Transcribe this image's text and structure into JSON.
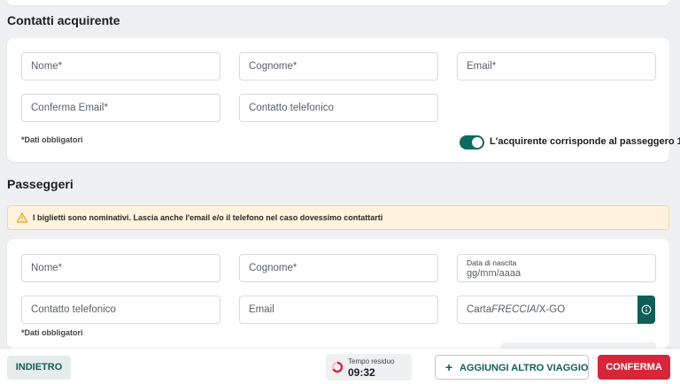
{
  "buyer": {
    "title": "Contatti acquirente",
    "nome_placeholder": "Nome*",
    "cognome_placeholder": "Cognome*",
    "email_placeholder": "Email*",
    "confirm_email_placeholder": "Conferma Email*",
    "phone_placeholder": "Contatto telefonico",
    "required_note": "*Dati obbligatori",
    "toggle_on": true,
    "toggle_label": "L'acquirente corrisponde al passeggero 1"
  },
  "passengers": {
    "title": "Passeggeri",
    "alert_text": "I biglietti sono nominativi. Lascia anche l'email e/o il telefono nel caso dovessimo contattarti",
    "nome_placeholder": "Nome*",
    "cognome_placeholder": "Cognome*",
    "birth_label": "Data di nascita",
    "birth_placeholder": "gg/mm/aaaa",
    "phone_placeholder": "Contatto telefonico",
    "email_placeholder": "Email",
    "card_prefix": "Carta",
    "card_brand": "FRECCIA",
    "card_suffix": "/X-GO",
    "required_note": "*Dati obbligatori"
  },
  "footer": {
    "back_label": "INDIETRO",
    "timer_label": "Tempo residuo",
    "timer_value": "09:32",
    "add_trip_label": "AGGIUNGI ALTRO VIAGGIO",
    "confirm_label": "CONFERMA"
  },
  "colors": {
    "accent": "#0e5f56",
    "confirm": "#d9253a",
    "warning_bg": "#fdf3de"
  }
}
